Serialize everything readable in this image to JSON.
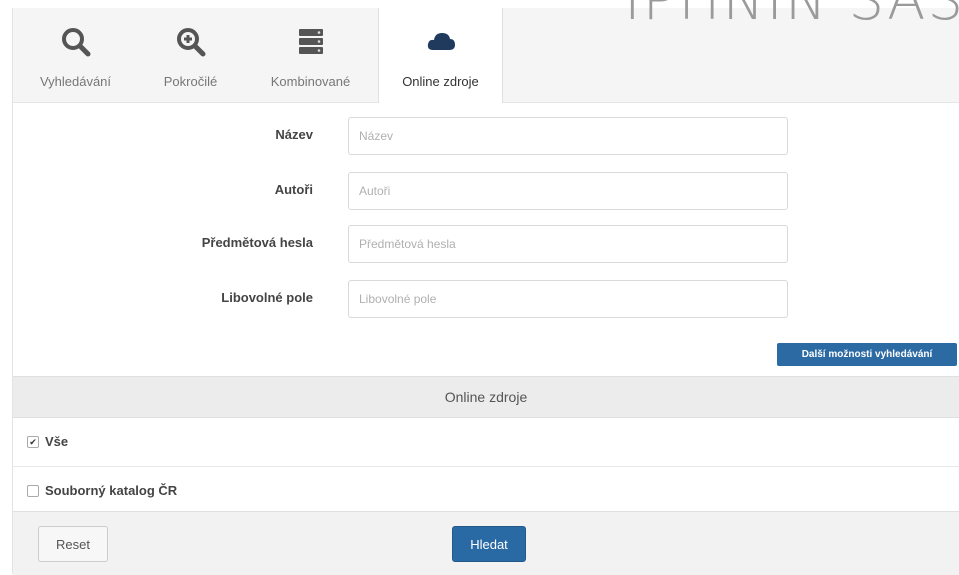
{
  "background_title": "IPHNIN SAS",
  "tabs": [
    {
      "label": "Vyhledávání",
      "icon": "search-icon"
    },
    {
      "label": "Pokročilé",
      "icon": "zoom-in-icon"
    },
    {
      "label": "Kombinované",
      "icon": "server-stack-icon"
    },
    {
      "label": "Online zdroje",
      "icon": "cloud-icon"
    }
  ],
  "active_tab": "Online zdroje",
  "form": {
    "fields": [
      {
        "label": "Název",
        "placeholder": "Název"
      },
      {
        "label": "Autoři",
        "placeholder": "Autoři"
      },
      {
        "label": "Předmětová hesla",
        "placeholder": "Předmětová hesla"
      },
      {
        "label": "Libovolné pole",
        "placeholder": "Libovolné pole"
      }
    ],
    "more_options_label": "Další možnosti vyhledávání"
  },
  "sources": {
    "heading": "Online zdroje",
    "items": [
      {
        "label": "Vše",
        "checked": true,
        "mark": "✔"
      },
      {
        "label": "Souborný katalog ČR",
        "checked": false,
        "mark": ""
      }
    ]
  },
  "footer": {
    "reset_label": "Reset",
    "search_label": "Hledat"
  },
  "colors": {
    "primary": "#2a6aa4",
    "tab_icon": "#555555",
    "active_icon": "#1f3a5c"
  }
}
